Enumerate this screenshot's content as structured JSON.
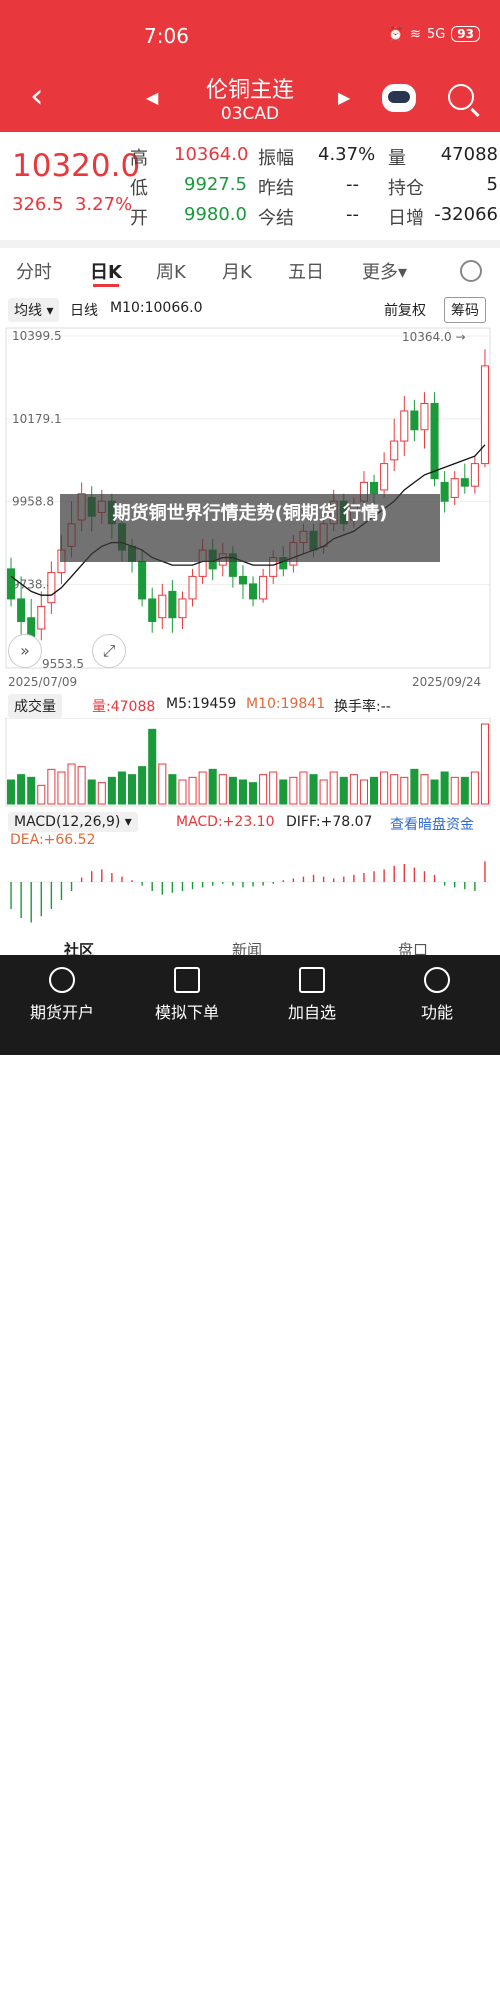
{
  "status": {
    "time": "7:06",
    "battery": "93",
    "signal": "5G"
  },
  "header": {
    "title": "伦铜主连",
    "code": "03CAD"
  },
  "quote": {
    "price": "10320.0",
    "change": "326.5",
    "change_pct": "3.27%",
    "high_label": "高",
    "high": "10364.0",
    "low_label": "低",
    "low": "9927.5",
    "open_label": "开",
    "open": "9980.0",
    "amp_label": "振幅",
    "amp": "4.37%",
    "settle_label": "昨结",
    "settle": "--",
    "today_settle_label": "今结",
    "today_settle": "--",
    "vol_label": "量",
    "vol": "47088",
    "oi_label": "持仓",
    "oi": "5",
    "daily_label": "日增",
    "daily": "-32066"
  },
  "tabs": [
    "分时",
    "日K",
    "周K",
    "月K",
    "五日",
    "更多▾"
  ],
  "chart_toolbar": {
    "ma_select": "均线 ▾",
    "line": "日线",
    "ma10": "M10:10066.0",
    "adjust": "前复权",
    "chips": "筹码"
  },
  "chart_data": {
    "type": "candlestick",
    "y_ticks": [
      "10399.5",
      "10179.1",
      "9958.8",
      "9738.4"
    ],
    "ylim": [
      9553.5,
      10399.5
    ],
    "high_marker": "10364.0",
    "low_marker": "9553.5",
    "date_start": "2025/07/09",
    "date_end": "2025/09/24",
    "candles": [
      [
        9780,
        9700,
        9810,
        9680
      ],
      [
        9700,
        9640,
        9760,
        9600
      ],
      [
        9650,
        9600,
        9700,
        9570
      ],
      [
        9620,
        9680,
        9720,
        9590
      ],
      [
        9690,
        9770,
        9800,
        9660
      ],
      [
        9770,
        9830,
        9870,
        9740
      ],
      [
        9840,
        9900,
        9960,
        9810
      ],
      [
        9910,
        9980,
        10010,
        9880
      ],
      [
        9970,
        9920,
        10000,
        9880
      ],
      [
        9930,
        9960,
        9990,
        9900
      ],
      [
        9960,
        9900,
        9980,
        9860
      ],
      [
        9900,
        9830,
        9920,
        9800
      ],
      [
        9840,
        9800,
        9860,
        9770
      ],
      [
        9800,
        9700,
        9830,
        9680
      ],
      [
        9700,
        9640,
        9730,
        9610
      ],
      [
        9650,
        9710,
        9740,
        9620
      ],
      [
        9720,
        9650,
        9750,
        9610
      ],
      [
        9650,
        9700,
        9720,
        9620
      ],
      [
        9700,
        9760,
        9780,
        9680
      ],
      [
        9760,
        9830,
        9860,
        9740
      ],
      [
        9830,
        9780,
        9860,
        9750
      ],
      [
        9790,
        9820,
        9850,
        9760
      ],
      [
        9820,
        9760,
        9840,
        9730
      ],
      [
        9760,
        9740,
        9790,
        9700
      ],
      [
        9740,
        9700,
        9760,
        9680
      ],
      [
        9700,
        9760,
        9780,
        9690
      ],
      [
        9760,
        9810,
        9830,
        9740
      ],
      [
        9810,
        9780,
        9840,
        9760
      ],
      [
        9790,
        9850,
        9870,
        9770
      ],
      [
        9850,
        9880,
        9900,
        9820
      ],
      [
        9880,
        9830,
        9900,
        9810
      ],
      [
        9840,
        9900,
        9920,
        9820
      ],
      [
        9900,
        9960,
        9990,
        9880
      ],
      [
        9960,
        9900,
        9980,
        9880
      ],
      [
        9910,
        9950,
        9970,
        9890
      ],
      [
        9960,
        10010,
        10040,
        9940
      ],
      [
        10010,
        9980,
        10030,
        9950
      ],
      [
        9990,
        10060,
        10090,
        9970
      ],
      [
        10070,
        10120,
        10180,
        10040
      ],
      [
        10120,
        10200,
        10240,
        10080
      ],
      [
        10200,
        10150,
        10230,
        10120
      ],
      [
        10150,
        10220,
        10250,
        10100
      ],
      [
        10220,
        10020,
        10250,
        10000
      ],
      [
        10010,
        9960,
        10040,
        9930
      ],
      [
        9970,
        10020,
        10040,
        9950
      ],
      [
        10020,
        10000,
        10060,
        9980
      ],
      [
        10000,
        10060,
        10080,
        9980
      ],
      [
        10060,
        10320,
        10364,
        10050
      ]
    ],
    "ma_series": [
      9760,
      9740,
      9720,
      9710,
      9710,
      9730,
      9760,
      9790,
      9820,
      9840,
      9850,
      9850,
      9840,
      9830,
      9810,
      9800,
      9790,
      9790,
      9790,
      9800,
      9800,
      9810,
      9810,
      9800,
      9790,
      9790,
      9790,
      9800,
      9810,
      9820,
      9830,
      9840,
      9860,
      9870,
      9880,
      9900,
      9920,
      9940,
      9960,
      9990,
      10010,
      10030,
      10040,
      10050,
      10060,
      10070,
      10080,
      10110
    ],
    "volume": {
      "label": "成交量",
      "vol": "量:47088",
      "m5": "M5:19459",
      "m10": "M10:19841",
      "turnover": "换手率:--",
      "values": [
        18,
        22,
        20,
        14,
        26,
        24,
        30,
        28,
        18,
        16,
        20,
        24,
        22,
        28,
        56,
        30,
        22,
        18,
        20,
        24,
        26,
        22,
        20,
        18,
        16,
        22,
        24,
        18,
        20,
        24,
        22,
        18,
        24,
        20,
        22,
        18,
        20,
        24,
        22,
        20,
        26,
        22,
        18,
        24,
        20,
        20,
        24,
        60
      ]
    },
    "macd": {
      "label": "MACD(12,26,9) ▾",
      "macd": "MACD:+23.10",
      "diff": "DIFF:+78.07",
      "dea": "DEA:+66.52",
      "hist": [
        -30,
        -40,
        -45,
        -38,
        -30,
        -20,
        -10,
        5,
        12,
        14,
        10,
        6,
        2,
        -4,
        -10,
        -14,
        -12,
        -10,
        -8,
        -6,
        -4,
        -2,
        -4,
        -6,
        -5,
        -4,
        -2,
        2,
        4,
        6,
        8,
        6,
        4,
        6,
        8,
        10,
        12,
        14,
        18,
        20,
        16,
        12,
        8,
        -4,
        -6,
        -8,
        -10,
        23
      ]
    }
  },
  "links": {
    "dark_pool": "查看暗盘资金"
  },
  "watermark": "期货铜世界行情走势(铜期货 行情)",
  "peek_tabs": [
    "社区",
    "新闻",
    "盘口"
  ],
  "bottom_nav": [
    {
      "label": "期货开户",
      "icon": "compass-icon"
    },
    {
      "label": "模拟下单",
      "icon": "document-icon"
    },
    {
      "label": "加自选",
      "icon": "plus-box-icon"
    },
    {
      "label": "功能",
      "icon": "menu-circle-icon"
    }
  ],
  "colors": {
    "accent": "#e8383d",
    "down": "#1a9a3a",
    "link": "#2f6bd8",
    "ma": "#111111",
    "dea": "#e06a3a"
  }
}
